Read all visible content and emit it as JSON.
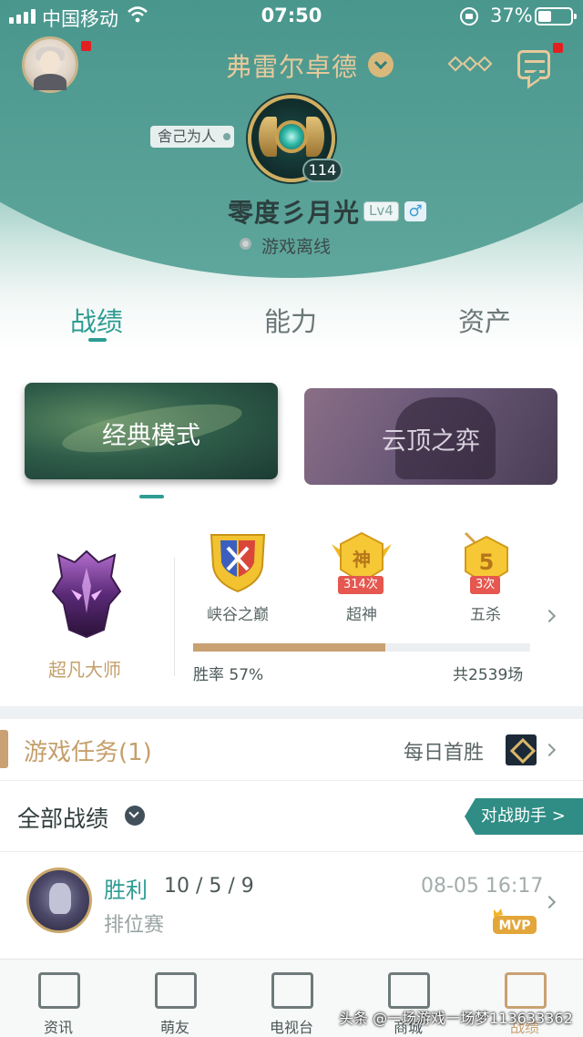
{
  "status_bar": {
    "carrier": "中国移动",
    "time": "07:50",
    "battery_percent": "37%",
    "battery_level": 0.37
  },
  "header": {
    "server_name": "弗雷尔卓德",
    "title_tag": "舍己为人",
    "rank_level": "114",
    "player_name": "零度彡月光",
    "player_level": "Lv4",
    "gender_symbol": "♂",
    "online_status": "游戏离线"
  },
  "tabs": [
    {
      "label": "战绩",
      "active": true
    },
    {
      "label": "能力",
      "active": false
    },
    {
      "label": "资产",
      "active": false
    }
  ],
  "modes": [
    {
      "label": "经典模式",
      "active": true
    },
    {
      "label": "云顶之弈",
      "active": false
    }
  ],
  "stats": {
    "rank_label": "超凡大师",
    "medals": [
      {
        "caption": "峡谷之巅",
        "count": "",
        "glyph": ""
      },
      {
        "caption": "超神",
        "count": "314次",
        "glyph": "神"
      },
      {
        "caption": "五杀",
        "count": "3次",
        "glyph": "5"
      }
    ],
    "win_rate_text": "胜率 57%",
    "win_rate": 0.57,
    "total_games": "共2539场"
  },
  "tasks": {
    "title": "游戏任务(1)",
    "daily_label": "每日首胜"
  },
  "records": {
    "header": "全部战绩",
    "assist_button": "对战助手 >"
  },
  "match": {
    "result": "胜利",
    "kda": "10 / 5 / 9",
    "time": "08-05 16:17",
    "type": "排位赛",
    "badge": "MVP"
  },
  "bottom_nav": [
    {
      "label": "资讯",
      "icon": "book-icon",
      "active": false
    },
    {
      "label": "萌友",
      "icon": "heart-chat-icon",
      "active": false
    },
    {
      "label": "电视台",
      "icon": "tv-icon",
      "active": false
    },
    {
      "label": "商城",
      "icon": "shop-icon",
      "active": false
    },
    {
      "label": "战绩",
      "icon": "record-icon",
      "active": true
    }
  ],
  "watermark": "头条 @一场游戏一场梦113633362",
  "colors": {
    "accent": "#2e9c93",
    "gold": "#c9a173",
    "header_teal": "#3d8d86"
  }
}
